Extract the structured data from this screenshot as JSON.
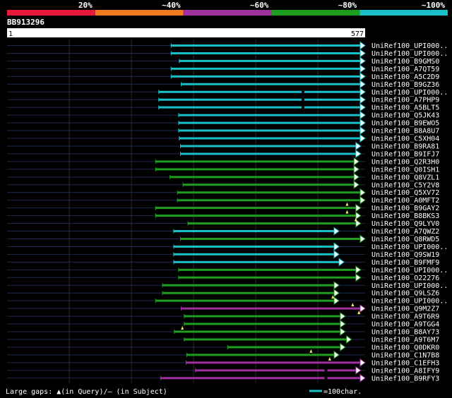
{
  "colors": {
    "background": "#000000",
    "band_lt20": "#e8183a",
    "band_20_40": "#f07a1c",
    "band_40_60": "#a0309e",
    "band_60_80": "#1e9e1e",
    "band_80_100": "#18c0c8",
    "gap_marker": "#f0f060",
    "query_line": "#1c2a55"
  },
  "legend_bands": [
    {
      "label": "",
      "color": "#e8183a"
    },
    {
      "label": "20%",
      "color": "#f07a1c"
    },
    {
      "label": "~40%",
      "color": "#a0309e"
    },
    {
      "label": "~60%",
      "color": "#1e9e1e"
    },
    {
      "label": "~80%",
      "color": "#18c0c8"
    },
    {
      "label": "~100%",
      "color": ""
    }
  ],
  "query": {
    "name": "BB913296",
    "start_label": "1",
    "end_label": "577"
  },
  "footer": {
    "gaps_note": "Large gaps: ▲(in Query)/– (in Subject)",
    "scale_note": "=100char."
  },
  "chart_data": {
    "type": "alignment",
    "query_length": 577,
    "hits": [
      {
        "id": "UniRef100_UPI000..",
        "start": 265,
        "end": 577,
        "band": "80_100",
        "gaps": []
      },
      {
        "id": "UniRef100_UPI000..",
        "start": 265,
        "end": 577,
        "band": "80_100",
        "gaps": []
      },
      {
        "id": "UniRef100_B9GMS0",
        "start": 278,
        "end": 577,
        "band": "80_100",
        "gaps": []
      },
      {
        "id": "UniRef100_A7QT59",
        "start": 265,
        "end": 577,
        "band": "80_100",
        "gaps": []
      },
      {
        "id": "UniRef100_A5C2D9",
        "start": 265,
        "end": 577,
        "band": "80_100",
        "gaps": []
      },
      {
        "id": "UniRef100_B9GZ36",
        "start": 281,
        "end": 577,
        "band": "80_100",
        "gaps": []
      },
      {
        "id": "UniRef100_UPI000..",
        "start": 245,
        "end": 577,
        "band": "80_100",
        "gaps": [
          {
            "pos": 477,
            "type": "subject"
          }
        ]
      },
      {
        "id": "UniRef100_A7PHP9",
        "start": 245,
        "end": 577,
        "band": "80_100",
        "gaps": [
          {
            "pos": 477,
            "type": "subject"
          }
        ]
      },
      {
        "id": "UniRef100_A5BLT5",
        "start": 245,
        "end": 577,
        "band": "80_100",
        "gaps": [
          {
            "pos": 477,
            "type": "subject"
          }
        ]
      },
      {
        "id": "UniRef100_Q5JK43",
        "start": 277,
        "end": 577,
        "band": "80_100",
        "gaps": []
      },
      {
        "id": "UniRef100_B9EWO5",
        "start": 277,
        "end": 577,
        "band": "80_100",
        "gaps": []
      },
      {
        "id": "UniRef100_B8A8U7",
        "start": 277,
        "end": 577,
        "band": "80_100",
        "gaps": []
      },
      {
        "id": "UniRef100_C5XH04",
        "start": 278,
        "end": 577,
        "band": "80_100",
        "gaps": []
      },
      {
        "id": "UniRef100_B9RA81",
        "start": 280,
        "end": 570,
        "band": "80_100",
        "gaps": []
      },
      {
        "id": "UniRef100_B9IFJ7",
        "start": 280,
        "end": 570,
        "band": "80_100",
        "gaps": []
      },
      {
        "id": "UniRef100_Q2R3H0",
        "start": 240,
        "end": 567,
        "band": "60_80",
        "gaps": []
      },
      {
        "id": "UniRef100_Q0ISH1",
        "start": 240,
        "end": 567,
        "band": "60_80",
        "gaps": []
      },
      {
        "id": "UniRef100_Q8VZL1",
        "start": 263,
        "end": 567,
        "band": "60_80",
        "gaps": []
      },
      {
        "id": "UniRef100_C5Y2V8",
        "start": 284,
        "end": 567,
        "band": "60_80",
        "gaps": []
      },
      {
        "id": "UniRef100_Q5XV72",
        "start": 275,
        "end": 577,
        "band": "60_80",
        "gaps": []
      },
      {
        "id": "UniRef100_A0MFT2",
        "start": 275,
        "end": 577,
        "band": "60_80",
        "gaps": []
      },
      {
        "id": "UniRef100_B9GAY2",
        "start": 240,
        "end": 570,
        "band": "60_80",
        "gaps": [
          {
            "pos": 548,
            "type": "query"
          }
        ]
      },
      {
        "id": "UniRef100_B8BKS3",
        "start": 240,
        "end": 570,
        "band": "60_80",
        "gaps": [
          {
            "pos": 548,
            "type": "query"
          }
        ]
      },
      {
        "id": "UniRef100_Q9LYV0",
        "start": 292,
        "end": 570,
        "band": "60_80",
        "gaps": [
          {
            "pos": 562,
            "type": "query"
          }
        ]
      },
      {
        "id": "UniRef100_A7QWZ2",
        "start": 269,
        "end": 535,
        "band": "80_100",
        "gaps": []
      },
      {
        "id": "UniRef100_Q8RWD5",
        "start": 280,
        "end": 577,
        "band": "60_80",
        "gaps": []
      },
      {
        "id": "UniRef100_UPI000..",
        "start": 269,
        "end": 535,
        "band": "80_100",
        "gaps": []
      },
      {
        "id": "UniRef100_Q9SW19",
        "start": 269,
        "end": 535,
        "band": "80_100",
        "gaps": []
      },
      {
        "id": "UniRef100_B9FMF9",
        "start": 269,
        "end": 543,
        "band": "80_100",
        "gaps": []
      },
      {
        "id": "UniRef100_UPI000..",
        "start": 277,
        "end": 570,
        "band": "60_80",
        "gaps": []
      },
      {
        "id": "UniRef100_O22276",
        "start": 277,
        "end": 570,
        "band": "60_80",
        "gaps": []
      },
      {
        "id": "UniRef100_UPI000..",
        "start": 251,
        "end": 535,
        "band": "60_80",
        "gaps": []
      },
      {
        "id": "UniRef100_Q9LSZ6",
        "start": 251,
        "end": 535,
        "band": "60_80",
        "gaps": []
      },
      {
        "id": "UniRef100_UPI000..",
        "start": 240,
        "end": 535,
        "band": "60_80",
        "gaps": [
          {
            "pos": 525,
            "type": "query"
          }
        ]
      },
      {
        "id": "UniRef100_Q9M2Z7",
        "start": 281,
        "end": 577,
        "band": "40_60",
        "gaps": [
          {
            "pos": 557,
            "type": "query"
          }
        ]
      },
      {
        "id": "UniRef100_A9T6R9",
        "start": 286,
        "end": 545,
        "band": "60_80",
        "gaps": [
          {
            "pos": 567,
            "type": "query"
          }
        ]
      },
      {
        "id": "UniRef100_A9TGG4",
        "start": 286,
        "end": 545,
        "band": "60_80",
        "gaps": []
      },
      {
        "id": "UniRef100_B8AY73",
        "start": 270,
        "end": 545,
        "band": "60_80",
        "gaps": [
          {
            "pos": 283,
            "type": "query"
          }
        ]
      },
      {
        "id": "UniRef100_A9T6M7",
        "start": 286,
        "end": 555,
        "band": "60_80",
        "gaps": []
      },
      {
        "id": "UniRef100_Q0DKR0",
        "start": 356,
        "end": 545,
        "band": "60_80",
        "gaps": []
      },
      {
        "id": "UniRef100_C1N7B8",
        "start": 290,
        "end": 535,
        "band": "60_80",
        "gaps": [
          {
            "pos": 490,
            "type": "query"
          }
        ]
      },
      {
        "id": "UniRef100_C1EFH3",
        "start": 289,
        "end": 577,
        "band": "40_60",
        "gaps": [
          {
            "pos": 520,
            "type": "query"
          }
        ]
      },
      {
        "id": "UniRef100_A8IFY9",
        "start": 304,
        "end": 570,
        "band": "40_60",
        "gaps": [
          {
            "pos": 514,
            "type": "subject"
          }
        ]
      },
      {
        "id": "UniRef100_B9RFY3",
        "start": 248,
        "end": 577,
        "band": "40_60",
        "gaps": [
          {
            "pos": 514,
            "type": "subject"
          }
        ]
      }
    ]
  }
}
